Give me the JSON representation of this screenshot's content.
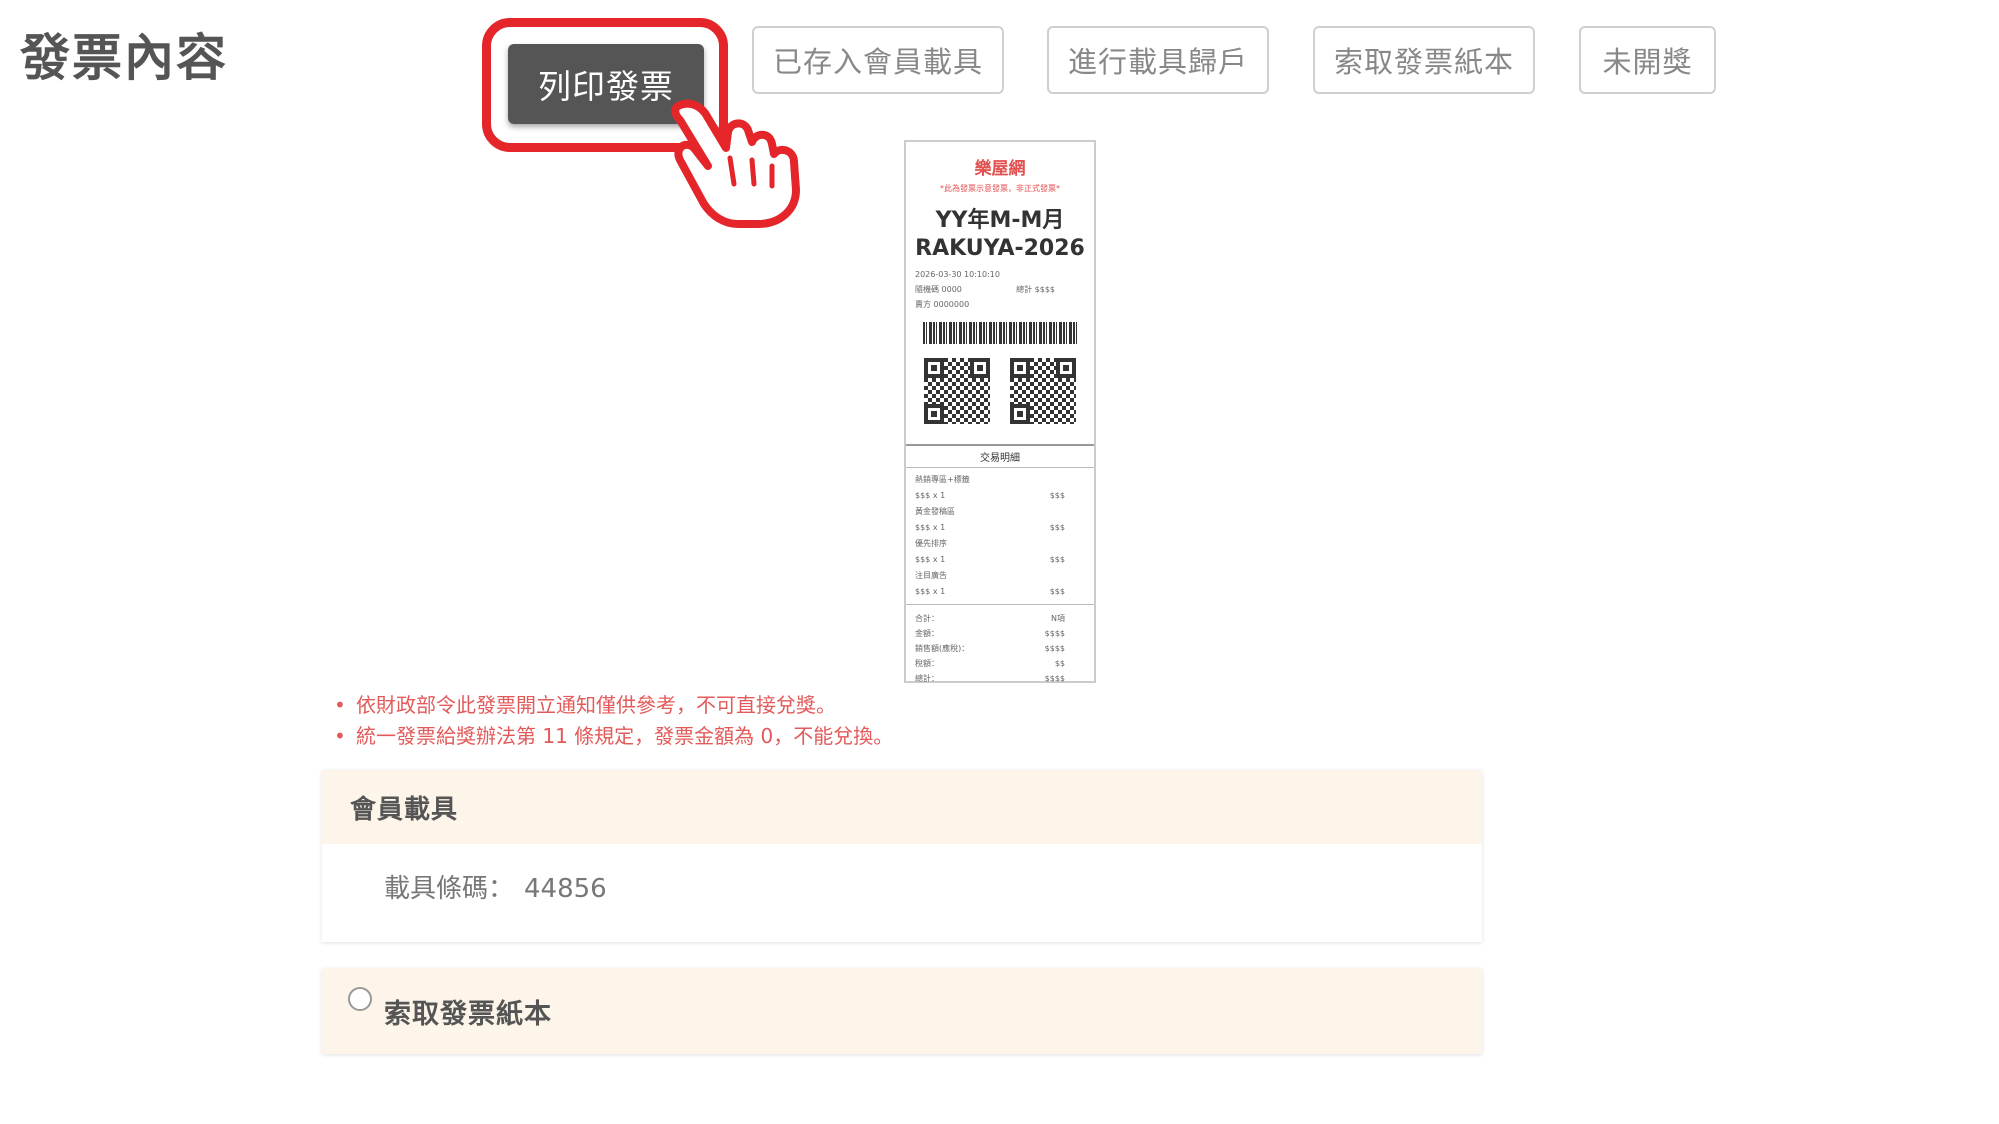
{
  "header": {
    "title": "發票內容"
  },
  "actions": {
    "print": "列印發票",
    "stored_in_member_carrier": "已存入會員載具",
    "carrier_assignment": "進行載具歸戶",
    "request_paper": "索取發票紙本",
    "not_drawn": "未開獎"
  },
  "receipt": {
    "brand": "樂屋網",
    "note": "*此為發票示意發票，非正式發票*",
    "period": "YY年M-M月",
    "invoice_number": "RAKUYA-2026",
    "datetime": "2026-03-30 10:10:10",
    "random_label": "隨機碼 0000",
    "total_label": "總計 $$$$",
    "seller_label": "賣方 0000000",
    "section_title": "交易明細",
    "items": [
      {
        "name": "熱銷專區+標籤",
        "qty": "$$$ x 1",
        "price": "$$$"
      },
      {
        "name": "黃金發稿區",
        "qty": "$$$ x 1",
        "price": "$$$"
      },
      {
        "name": "優先排序",
        "qty": "$$$ x 1",
        "price": "$$$"
      },
      {
        "name": "注目廣告",
        "qty": "$$$ x 1",
        "price": "$$$"
      }
    ],
    "totals": [
      {
        "label": "合計：",
        "value": "N項"
      },
      {
        "label": "金額：",
        "value": "$$$$"
      },
      {
        "label": "銷售額(應稅)：",
        "value": "$$$$"
      },
      {
        "label": "稅額：",
        "value": "$$"
      },
      {
        "label": "總計：",
        "value": "$$$$"
      }
    ]
  },
  "notices": [
    "依財政部令此發票開立通知僅供參考，不可直接兌獎。",
    "統一發票給獎辦法第 11 條規定，發票金額為 0，不能兌換。"
  ],
  "member_carrier": {
    "title": "會員載具",
    "barcode_label": "載具條碼：",
    "barcode_value": "44856"
  },
  "paper_request": {
    "label": "索取發票紙本"
  },
  "colors": {
    "accent_red": "#e4262a",
    "notice_red": "#e35a5a",
    "panel_header": "#fdf5ea"
  },
  "icons": {
    "pointer": "hand-pointer-icon",
    "radio": "radio-unchecked-icon"
  }
}
